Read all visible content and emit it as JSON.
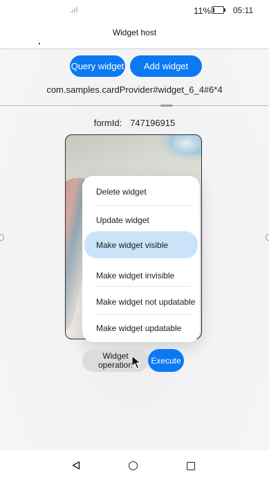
{
  "status_bar": {
    "battery_percent": "11%",
    "battery_level": 0.11,
    "time": "05:11",
    "signal_icon": "signal-icon",
    "battery_icon": "battery-icon"
  },
  "header": {
    "title": "Widget host"
  },
  "actions": {
    "query_label": "Query widget",
    "add_label": "Add widget"
  },
  "card_name": "com.samples.cardProvider#widget_6_4#6*4",
  "form": {
    "label": "formId:",
    "value": "747196915"
  },
  "menu": {
    "items": [
      {
        "label": "Delete widget",
        "highlighted": false
      },
      {
        "label": "Update widget",
        "highlighted": false
      },
      {
        "label": "Make widget visible",
        "highlighted": true
      },
      {
        "label": "Make widget invisible",
        "highlighted": false
      },
      {
        "label": "Make widget not updatable",
        "highlighted": false
      },
      {
        "label": "Make widget updatable",
        "highlighted": false
      }
    ]
  },
  "operation": {
    "select_label_line1": "Widget",
    "select_label_line2": "operation",
    "execute_label": "Execute"
  },
  "nav": {
    "back_icon": "back-triangle-icon",
    "home_icon": "home-circle-icon",
    "recent_icon": "recent-square-icon"
  },
  "colors": {
    "accent": "#0a79f2",
    "highlight": "#cbe3f8",
    "secondary_button": "#dcdcdc"
  }
}
